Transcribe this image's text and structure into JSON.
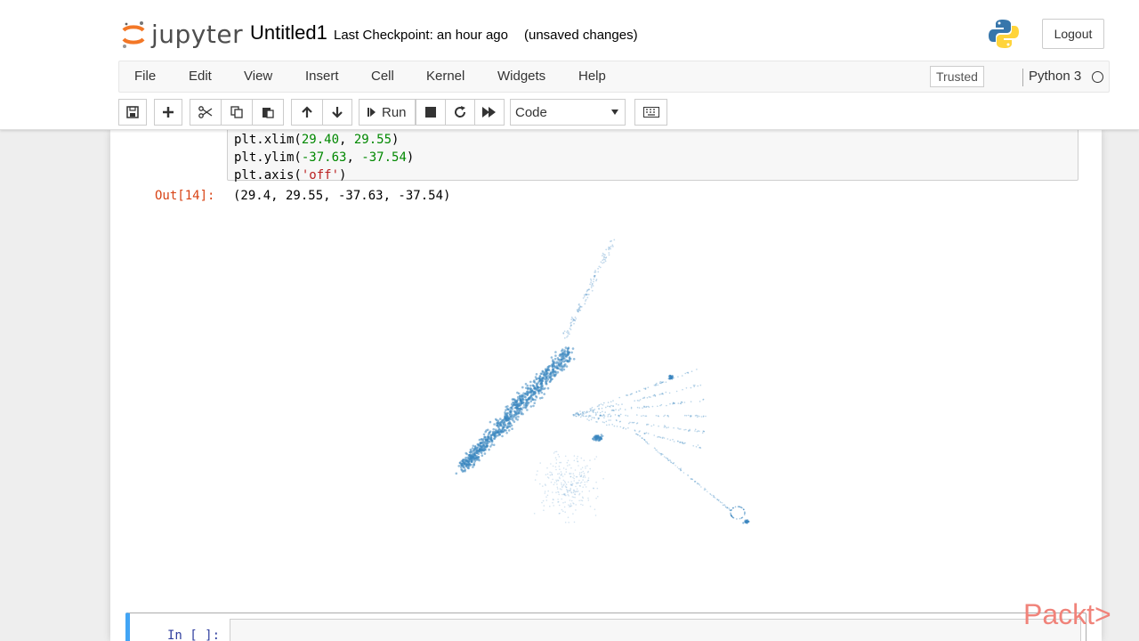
{
  "header": {
    "logo_text": "jupyter",
    "notebook_name": "Untitled1",
    "checkpoint": "Last Checkpoint: an hour ago",
    "save_status": "(unsaved changes)",
    "logout_label": "Logout"
  },
  "menubar": {
    "items": [
      "File",
      "Edit",
      "View",
      "Insert",
      "Cell",
      "Kernel",
      "Widgets",
      "Help"
    ],
    "trusted_label": "Trusted",
    "kernel_name": "Python 3"
  },
  "toolbar": {
    "run_label": "Run",
    "cell_type": "Code"
  },
  "cells": {
    "code_lines": [
      [
        {
          "t": "plt.xlim(",
          "c": ""
        },
        {
          "t": "29.40",
          "c": "num"
        },
        {
          "t": ", ",
          "c": ""
        },
        {
          "t": "29.55",
          "c": "num"
        },
        {
          "t": ")",
          "c": ""
        }
      ],
      [
        {
          "t": "plt.ylim(",
          "c": ""
        },
        {
          "t": "-37.63",
          "c": "num"
        },
        {
          "t": ", ",
          "c": ""
        },
        {
          "t": "-37.54",
          "c": "num"
        },
        {
          "t": ")",
          "c": ""
        }
      ],
      [
        {
          "t": "plt.axis(",
          "c": ""
        },
        {
          "t": "'off'",
          "c": "str"
        },
        {
          "t": ")",
          "c": ""
        }
      ]
    ],
    "out_prompt": "Out[14]:",
    "out_text": "(29.4, 29.55, -37.63, -37.54)",
    "in_prompt": "In [ ]:"
  },
  "plot": {
    "point_color": "#3a86c0"
  },
  "watermark": "Packt>"
}
